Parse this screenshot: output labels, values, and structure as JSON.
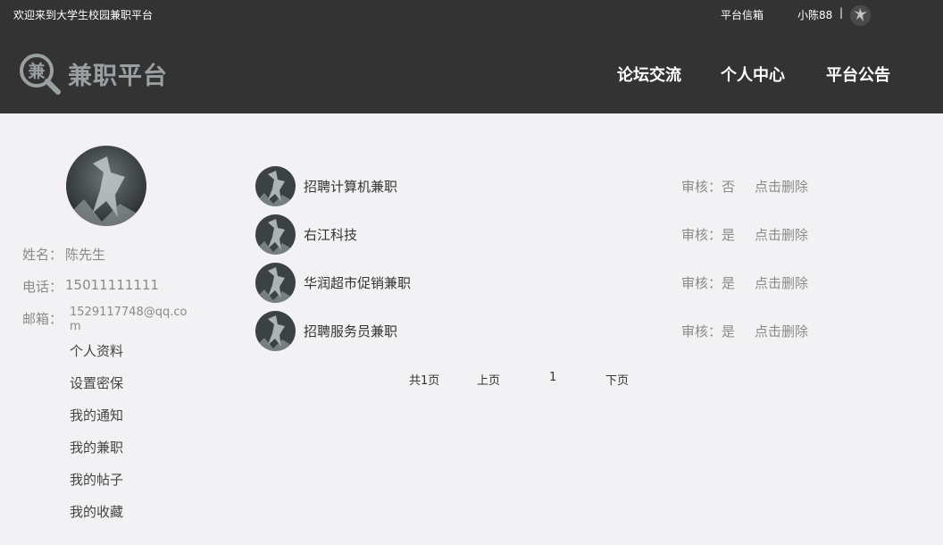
{
  "topbar": {
    "welcome": "欢迎来到大学生校园兼职平台",
    "mailbox": "平台信箱",
    "username": "小陈88",
    "separator": "|"
  },
  "header": {
    "logo_char": "兼",
    "logo_text": "兼职平台",
    "nav": [
      "论坛交流",
      "个人中心",
      "平台公告"
    ]
  },
  "profile": {
    "name_label": "姓名：",
    "name": "陈先生",
    "phone_label": "电话：",
    "phone": "15011111111",
    "email_label": "邮箱：",
    "email": "1529117748@qq.com"
  },
  "sidebar": {
    "links": [
      "个人资料",
      "设置密保",
      "我的通知",
      "我的兼职",
      "我的帖子",
      "我的收藏"
    ]
  },
  "jobs": [
    {
      "title": "招聘计算机兼职",
      "review": "审核：否",
      "delete": "点击删除"
    },
    {
      "title": "右江科技",
      "review": "审核：是",
      "delete": "点击删除"
    },
    {
      "title": "华润超市促销兼职",
      "review": "审核：是",
      "delete": "点击删除"
    },
    {
      "title": "招聘服务员兼职",
      "review": "审核：是",
      "delete": "点击删除"
    }
  ],
  "pagination": {
    "total": "共1页",
    "prev": "上页",
    "current": "1",
    "next": "下页"
  },
  "colors": {
    "header_bg": "#333333",
    "page_bg": "#f2f2f4",
    "logo": "#9aa0a2"
  }
}
